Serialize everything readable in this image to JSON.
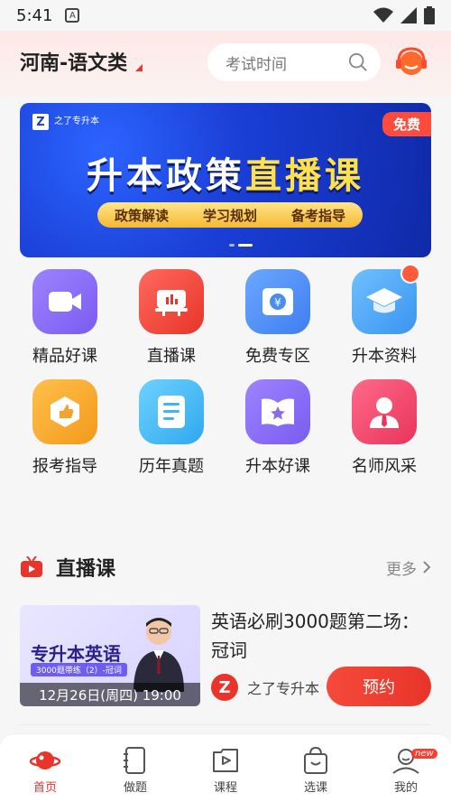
{
  "status_bar": {
    "time": "5:41",
    "a_label": "A"
  },
  "header": {
    "region": "河南-语文类",
    "search_placeholder": "考试时间"
  },
  "banner": {
    "logo_text": "之了专升本",
    "badge": "免费",
    "title_part1": "升本政策",
    "title_part2": "直播课",
    "tags": [
      "政策解读",
      "学习规划",
      "备考指导"
    ]
  },
  "grid": [
    {
      "label": "精品好课",
      "icon": "video-camera-icon",
      "color": "#8a6bf0"
    },
    {
      "label": "直播课",
      "icon": "live-board-icon",
      "color": "#f0504a"
    },
    {
      "label": "免费专区",
      "icon": "coin-safe-icon",
      "color": "#4a8cf0"
    },
    {
      "label": "升本资料",
      "icon": "graduation-cap-icon",
      "color": "#4aa8f0"
    },
    {
      "label": "报考指导",
      "icon": "thumbs-up-icon",
      "color": "#f4a42c"
    },
    {
      "label": "历年真题",
      "icon": "document-icon",
      "color": "#3fb6f0"
    },
    {
      "label": "升本好课",
      "icon": "star-book-icon",
      "color": "#8a6bf0"
    },
    {
      "label": "名师风采",
      "icon": "teacher-icon",
      "color": "#f04a6a"
    }
  ],
  "live_section": {
    "title": "直播课",
    "more": "更多",
    "course": {
      "thumb_title": "专升本英语",
      "thumb_sub": "3000题带练（2）-冠词",
      "thumb_time": "12月26日(周四) 19:00",
      "title": "英语必刷3000题第二场：冠词",
      "org": "之了专升本",
      "org_logo": "Z",
      "button": "预约"
    }
  },
  "tabbar": [
    {
      "label": "首页",
      "icon": "planet-icon",
      "active": true
    },
    {
      "label": "做题",
      "icon": "notebook-icon",
      "active": false
    },
    {
      "label": "课程",
      "icon": "play-icon",
      "active": false
    },
    {
      "label": "选课",
      "icon": "bag-icon",
      "active": false
    },
    {
      "label": "我的",
      "icon": "profile-icon",
      "active": false,
      "badge": "new"
    }
  ]
}
